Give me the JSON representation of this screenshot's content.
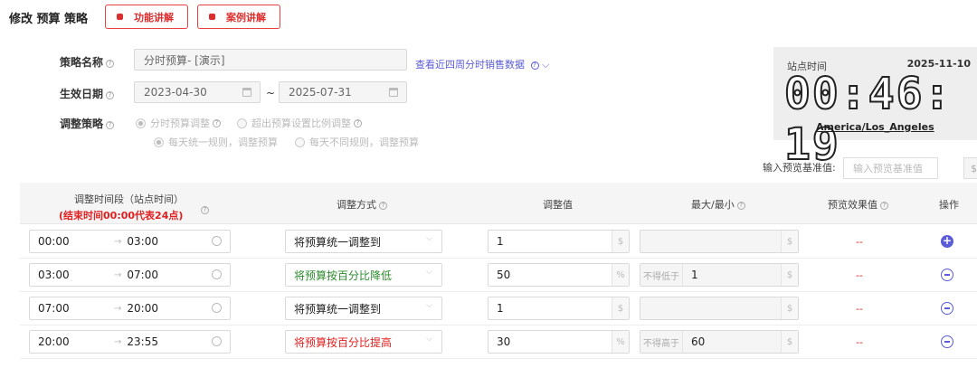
{
  "header": {
    "title": "修改 预算 策略",
    "btn_feature": "功能讲解",
    "btn_case": "案例讲解"
  },
  "form": {
    "name_label": "策略名称",
    "name_value": "分时预算- [演示]",
    "sales_link": "查看近四周分时销售数据",
    "date_label": "生效日期",
    "date_start": "2023-04-30",
    "date_sep": "~",
    "date_end": "2025-07-31",
    "strategy_label": "调整策略",
    "strategy_opt1": "分时预算调整",
    "strategy_opt2": "超出预算设置比例调整",
    "rule_opt1": "每天统一规则，调整预算",
    "rule_opt2": "每天不同规则，调整预算"
  },
  "clock": {
    "label": "站点时间",
    "date": "2025-11-10",
    "time": "00:46: 19",
    "timezone": "America/Los_Angeles"
  },
  "preview": {
    "label": "输入预览基准值:",
    "placeholder": "输入预览基准值",
    "unit": "$"
  },
  "table": {
    "headers": {
      "period": "调整时间段（站点时间）",
      "period_note": "(结束时间00:00代表24点)",
      "method": "调整方式",
      "value": "调整值",
      "maxmin": "最大/最小",
      "preview": "预览效果值",
      "action": "操作"
    },
    "rows": [
      {
        "start": "00:00",
        "end": "03:00",
        "method": "将预算统一调整到",
        "method_color": "#222222",
        "value": "1",
        "value_unit": "$",
        "limit_prefix": "",
        "limit_value": "",
        "limit_unit": "$",
        "preview": "--"
      },
      {
        "start": "03:00",
        "end": "07:00",
        "method": "将预算按百分比降低",
        "method_color": "#2e8b2e",
        "value": "50",
        "value_unit": "%",
        "limit_prefix": "不得低于",
        "limit_value": "1",
        "limit_unit": "$",
        "preview": "--"
      },
      {
        "start": "07:00",
        "end": "20:00",
        "method": "将预算统一调整到",
        "method_color": "#222222",
        "value": "1",
        "value_unit": "$",
        "limit_prefix": "",
        "limit_value": "",
        "limit_unit": "$",
        "preview": "--"
      },
      {
        "start": "20:00",
        "end": "23:55",
        "method": "将预算按百分比提高",
        "method_color": "#e02020",
        "value": "30",
        "value_unit": "%",
        "limit_prefix": "不得高于",
        "limit_value": "60",
        "limit_unit": "$",
        "preview": "--"
      }
    ]
  }
}
